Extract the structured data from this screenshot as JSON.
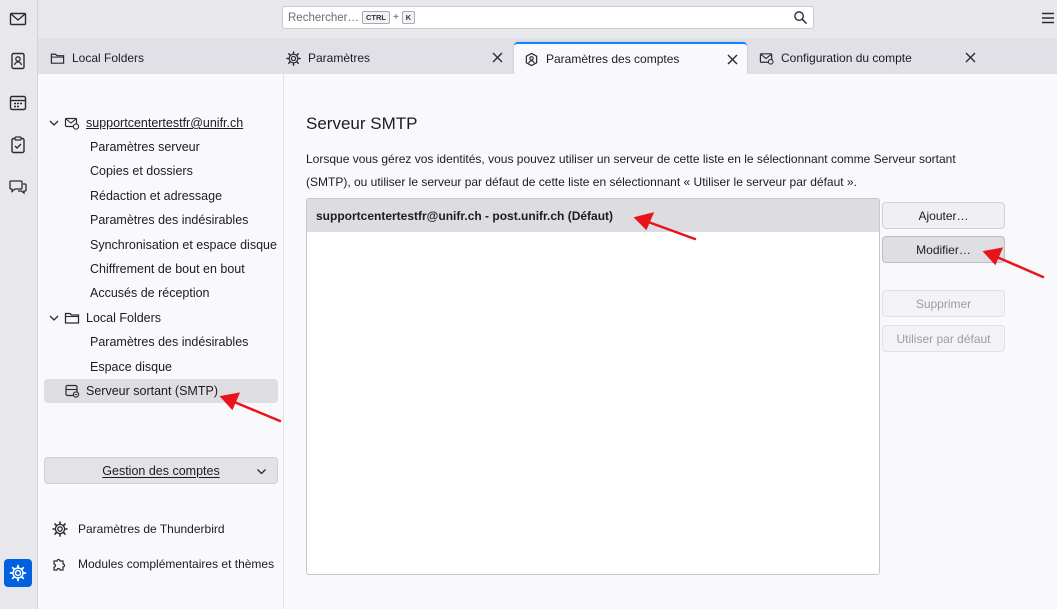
{
  "search": {
    "placeholder": "Rechercher…",
    "key_ctrl": "CTRL",
    "plus": "+",
    "key_k": "K"
  },
  "tabs": [
    {
      "label": "Local Folders",
      "icon": "folder-icon"
    },
    {
      "label": "Paramètres",
      "icon": "gear-icon"
    },
    {
      "label": "Paramètres des comptes",
      "icon": "account-settings-icon"
    },
    {
      "label": "Configuration du compte",
      "icon": "mail-config-icon"
    }
  ],
  "sidebar": {
    "account": "supportcentertestfr@unifr.ch",
    "account_items": [
      "Paramètres serveur",
      "Copies et dossiers",
      "Rédaction et adressage",
      "Paramètres des indésirables",
      "Synchronisation et espace disque",
      "Chiffrement de bout en bout",
      "Accusés de réception"
    ],
    "local_folders": "Local Folders",
    "local_items": [
      "Paramètres des indésirables",
      "Espace disque"
    ],
    "smtp": "Serveur sortant (SMTP)",
    "account_actions": "Gestion des comptes",
    "thunderbird_settings": "Paramètres de Thunderbird",
    "addons": "Modules complémentaires et thèmes"
  },
  "main": {
    "title": "Serveur SMTP",
    "description": "Lorsque vous gérez vos identités, vous pouvez utiliser un serveur de cette liste en le sélectionnant comme Serveur sortant (SMTP), ou utiliser le serveur par défaut de cette liste en sélectionnant « Utiliser le serveur par défaut ».",
    "servers": [
      "supportcentertestfr@unifr.ch - post.unifr.ch (Défaut)"
    ],
    "buttons": {
      "add": "Ajouter…",
      "edit": "Modifier…",
      "remove": "Supprimer",
      "set_default": "Utiliser par défaut"
    }
  },
  "colors": {
    "accent": "#0060df",
    "arrow": "#e8141b",
    "selection": "#dcdce1"
  }
}
